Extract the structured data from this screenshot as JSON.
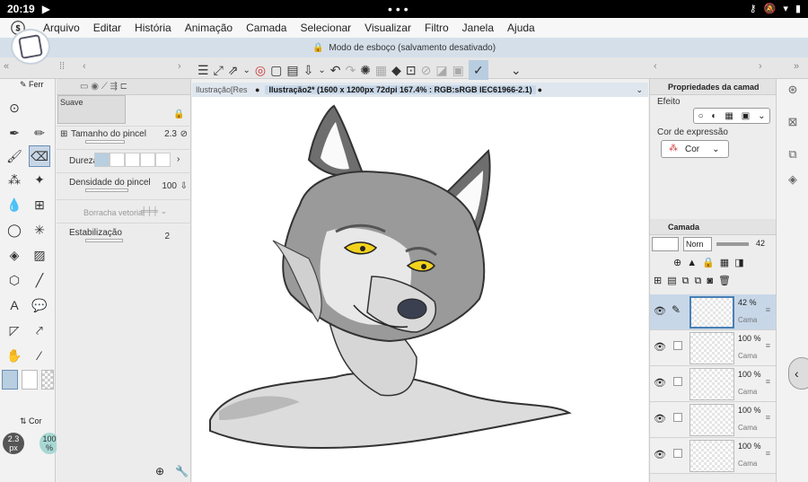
{
  "status": {
    "time": "20:19",
    "dots": "•••"
  },
  "menu": [
    "Arquivo",
    "Editar",
    "História",
    "Animação",
    "Camada",
    "Selecionar",
    "Visualizar",
    "Filtro",
    "Janela",
    "Ajuda"
  ],
  "banner": {
    "text": "Modo de esboço (salvamento desativado)"
  },
  "tool_panel": {
    "tab_label": "Ferr",
    "preset_name": "Suave",
    "brush_size_label": "Tamanho do pincel",
    "brush_size_value": "2.3",
    "hardness_label": "Dureza",
    "density_label": "Densidade do pincel",
    "density_value": "100",
    "vector_eraser_label": "Borracha vetorial",
    "stabilization_label": "Estabilização",
    "stabilization_value": "2"
  },
  "color_panel": {
    "tab_label": "Cor",
    "size_badge": "2.3 px",
    "opacity_badge": "100 %"
  },
  "canvas_tabs": [
    {
      "label": "Ilustração[Res",
      "active": false
    },
    {
      "label": "Ilustração2* (1600 x 1200px 72dpi 167.4% : RGB:sRGB IEC61966-2.1)",
      "active": true
    }
  ],
  "properties_panel": {
    "title": "Propriedades da camad",
    "effect_label": "Efeito",
    "expression_color_label": "Cor de expressão",
    "expression_color_value": "Cor"
  },
  "layer_panel": {
    "title": "Camada",
    "blend_mode": "Norn",
    "opacity": "42",
    "layers": [
      {
        "opacity": "42 %",
        "name": "Cama",
        "selected": true
      },
      {
        "opacity": "100 %",
        "name": "Cama",
        "selected": false
      },
      {
        "opacity": "100 %",
        "name": "Cama",
        "selected": false
      },
      {
        "opacity": "100 %",
        "name": "Cama",
        "selected": false
      },
      {
        "opacity": "100 %",
        "name": "Cama",
        "selected": false
      }
    ]
  },
  "colors": {
    "accent": "#6a8fb5",
    "banner_bg": "#d4dfe9",
    "main_color": "#b7cfe0",
    "sub_color": "#ffffff"
  }
}
